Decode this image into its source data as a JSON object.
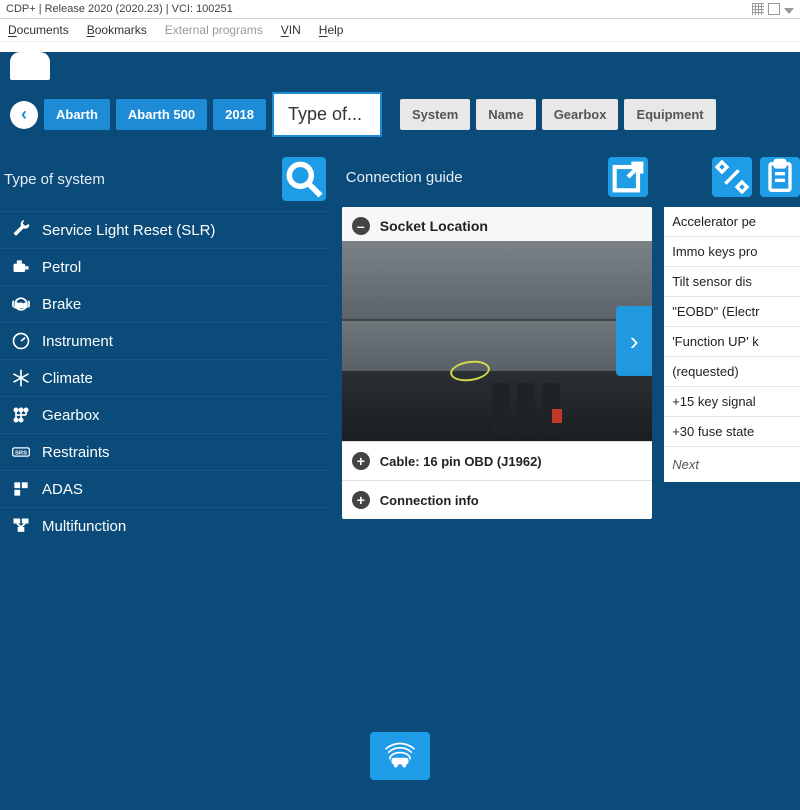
{
  "window": {
    "title": "CDP+ | Release 2020 (2020.23) | VCI: 100251"
  },
  "menubar": {
    "documents": "Documents",
    "bookmarks": "Bookmarks",
    "external": "External programs",
    "vin": "VIN",
    "help": "Help"
  },
  "breadcrumb": {
    "brand": "Abarth",
    "model": "Abarth 500",
    "year": "2018",
    "type_field": "Type of...",
    "grey": [
      "System",
      "Name",
      "Gearbox",
      "Equipment"
    ]
  },
  "left": {
    "title": "Type of system",
    "items": [
      "Service Light Reset (SLR)",
      "Petrol",
      "Brake",
      "Instrument",
      "Climate",
      "Gearbox",
      "Restraints",
      "ADAS",
      "Multifunction"
    ]
  },
  "mid": {
    "title": "Connection guide",
    "socket": "Socket Location",
    "cable": "Cable: 16 pin OBD (J1962)",
    "conninfo": "Connection info"
  },
  "right": {
    "items": [
      "Accelerator pe",
      "Immo keys pro",
      "Tilt sensor dis",
      "\"EOBD\" (Electr",
      "'Function UP' k",
      "(requested)",
      "+15 key signal",
      "+30 fuse state"
    ],
    "next": "Next"
  }
}
